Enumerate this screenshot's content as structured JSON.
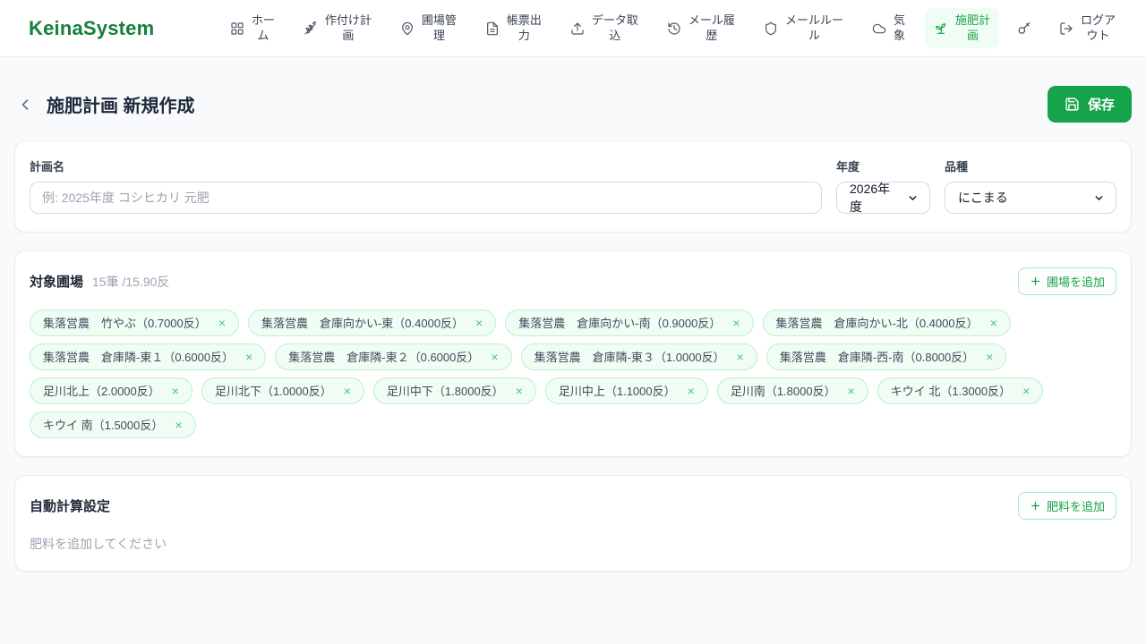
{
  "brand": "KeinaSystem",
  "nav": {
    "items": [
      {
        "label": "ホー\nム",
        "icon": "grid-icon",
        "active": false
      },
      {
        "label": "作付け計\n画",
        "icon": "wheat-icon",
        "active": false
      },
      {
        "label": "圃場管\n理",
        "icon": "map-pin-icon",
        "active": false
      },
      {
        "label": "帳票出\n力",
        "icon": "document-icon",
        "active": false
      },
      {
        "label": "データ取\n込",
        "icon": "upload-icon",
        "active": false
      },
      {
        "label": "メール履\n歴",
        "icon": "history-icon",
        "active": false
      },
      {
        "label": "メールルー\nル",
        "icon": "shield-icon",
        "active": false
      },
      {
        "label": "気\n象",
        "icon": "cloud-icon",
        "active": false
      },
      {
        "label": "施肥計\n画",
        "icon": "seedling-icon",
        "active": true
      },
      {
        "label": "ログア\nウト",
        "icon": "logout-icon",
        "active": false
      }
    ]
  },
  "header": {
    "title": "施肥計画 新規作成",
    "save_label": "保存"
  },
  "form": {
    "plan_name": {
      "label": "計画名",
      "placeholder": "例: 2025年度 コシヒカリ 元肥",
      "value": ""
    },
    "year": {
      "label": "年度",
      "value": "2026年度"
    },
    "variety": {
      "label": "品種",
      "value": "にこまる"
    }
  },
  "fields": {
    "title": "対象圃場",
    "summary": "15筆 /15.90反",
    "add_label": "圃場を追加",
    "remove_symbol": "×",
    "chips": [
      {
        "label": "集落営農　竹やぶ（0.7000反）"
      },
      {
        "label": "集落営農　倉庫向かい-東（0.4000反）"
      },
      {
        "label": "集落営農　倉庫向かい-南（0.9000反）"
      },
      {
        "label": "集落営農　倉庫向かい-北（0.4000反）"
      },
      {
        "label": "集落営農　倉庫隣-東１（0.6000反）"
      },
      {
        "label": "集落営農　倉庫隣-東２（0.6000反）"
      },
      {
        "label": "集落営農　倉庫隣-東３（1.0000反）"
      },
      {
        "label": "集落営農　倉庫隣-西-南（0.8000反）"
      },
      {
        "label": "足川北上（2.0000反）"
      },
      {
        "label": "足川北下（1.0000反）"
      },
      {
        "label": "足川中下（1.8000反）"
      },
      {
        "label": "足川中上（1.1000反）"
      },
      {
        "label": "足川南（1.8000反）"
      },
      {
        "label": "キウイ 北（1.3000反）"
      },
      {
        "label": "キウイ 南（1.5000反）"
      }
    ]
  },
  "fertilizer": {
    "title": "自動計算設定",
    "add_label": "肥料を追加",
    "empty": "肥料を追加してください"
  },
  "colors": {
    "accent": "#16a34a",
    "brand_green": "#15803d",
    "chip_bg": "#f0fdf4",
    "chip_border": "#bbf0ca"
  }
}
